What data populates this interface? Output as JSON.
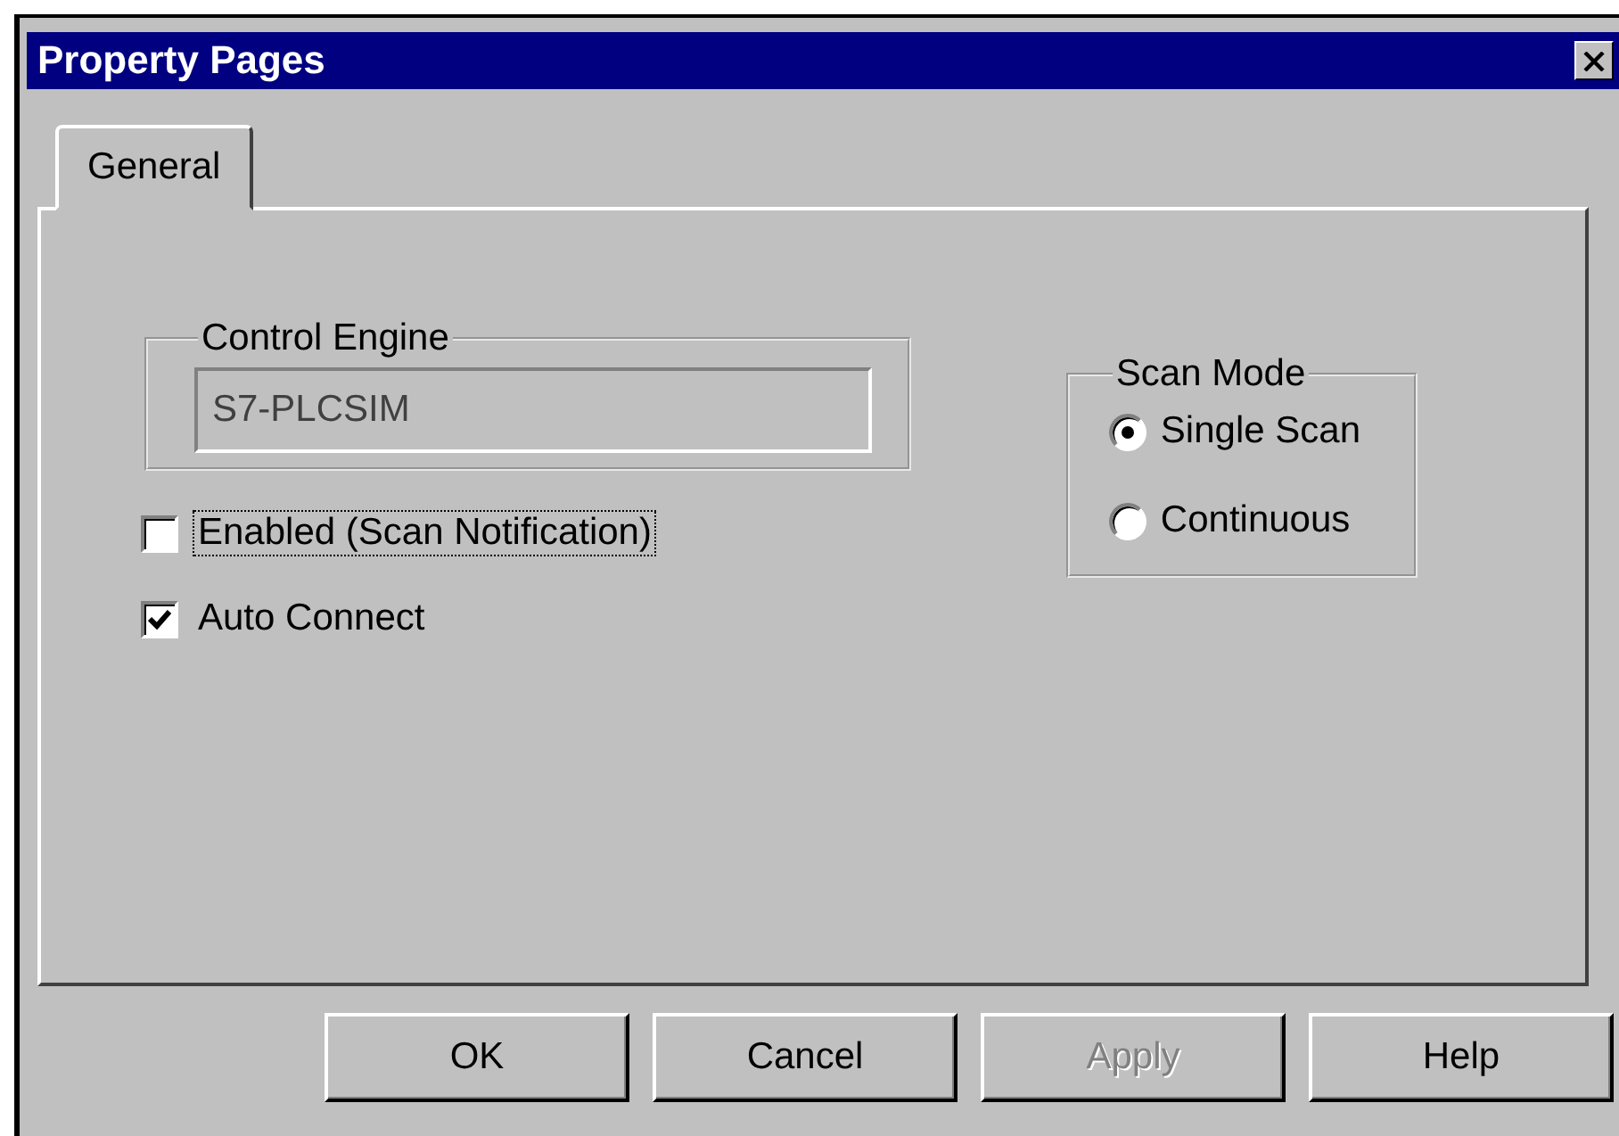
{
  "window": {
    "title": "Property Pages"
  },
  "tabs": [
    {
      "label": "General",
      "selected": true
    }
  ],
  "control_engine": {
    "label": "Control Engine",
    "value": "S7-PLCSIM",
    "disabled": true
  },
  "scan_mode": {
    "label": "Scan Mode",
    "options": [
      {
        "label": "Single Scan",
        "selected": true
      },
      {
        "label": "Continuous",
        "selected": false
      }
    ]
  },
  "checkboxes": [
    {
      "label": "Enabled (Scan Notification)",
      "checked": false,
      "focused": true
    },
    {
      "label": "Auto Connect",
      "checked": true,
      "focused": false
    }
  ],
  "buttons": [
    {
      "label": "OK",
      "disabled": false
    },
    {
      "label": "Cancel",
      "disabled": false
    },
    {
      "label": "Apply",
      "disabled": true
    },
    {
      "label": "Help",
      "disabled": false
    }
  ]
}
